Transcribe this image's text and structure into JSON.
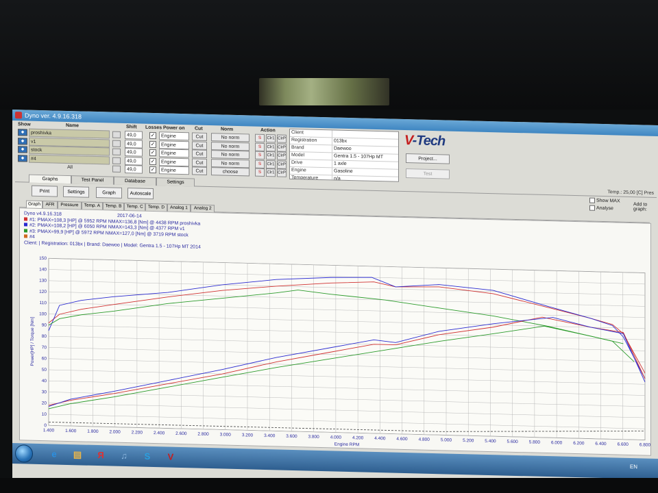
{
  "window": {
    "title": "Dyno ver. 4.9.16.318"
  },
  "channels": {
    "headers": {
      "show": "Show",
      "name": "Name",
      "shift": "Shift",
      "losses": "Losses",
      "power_on": "Power on",
      "cut": "Cut",
      "norm": "Norm",
      "action": "Action"
    },
    "rows": [
      {
        "name": "proshivka",
        "shift": "49,0",
        "power_on": "Engine",
        "cut": "Cut",
        "norm": "No norm"
      },
      {
        "name": "v1",
        "shift": "49,0",
        "power_on": "Engine",
        "cut": "Cut",
        "norm": "No norm"
      },
      {
        "name": "stock",
        "shift": "49,0",
        "power_on": "Engine",
        "cut": "Cut",
        "norm": "No norm"
      },
      {
        "name": "#4",
        "shift": "49,0",
        "power_on": "Engine",
        "cut": "Cut",
        "norm": "No norm"
      },
      {
        "name": "All",
        "shift": "49,0",
        "power_on": "Engine",
        "cut": "Cut",
        "norm": "choose"
      }
    ],
    "action_labels": {
      "clear": "Clr1",
      "copy": "ClrP"
    }
  },
  "client_info": [
    {
      "k": "Client",
      "v": ""
    },
    {
      "k": "Registration",
      "v": "013bx"
    },
    {
      "k": "Brand",
      "v": "Daewoo"
    },
    {
      "k": "Model",
      "v": "Gentra 1.5 - 107Hp MT"
    },
    {
      "k": "Drive",
      "v": "1 axle"
    },
    {
      "k": "Engine",
      "v": "Gasoline"
    },
    {
      "k": "Temperature",
      "v": "n/a"
    }
  ],
  "logo": {
    "v": "V",
    "rest": "-Tech"
  },
  "buttons": {
    "project": "Project...",
    "test": "Test",
    "print": "Print",
    "settings": "Settings",
    "graph": "Graph",
    "autoscale": "Autoscale"
  },
  "tabs": [
    "Graphs",
    "Test Panel",
    "Database",
    "Settings"
  ],
  "temp_readout": "Temp.: 25,00 [C]   Pres",
  "options": {
    "show_max": "Show MAX",
    "analyse": "Analyse",
    "add_to_graph": "Add to graph:"
  },
  "subtabs": [
    "Graph",
    "AFR",
    "Pressure",
    "Temp. A",
    "Temp. B",
    "Temp. C",
    "Temp. D",
    "Analog 1",
    "Analog 2"
  ],
  "legend": {
    "version": "Dyno v4.9.16.318",
    "date": "2017-06-14",
    "lines": [
      {
        "text": "#1: PMAX=108,3 [HP] @ 5952 RPM    NMAX=136,8 [Nm] @ 4438 RPM   proshivka",
        "color": "#d03030"
      },
      {
        "text": "#2: PMAX=108,2 [HP] @ 6050 RPM    NMAX=143,3 [Nm] @ 4377 RPM   v1",
        "color": "#2a2ad0"
      },
      {
        "text": "#3: PMAX=99,9 [HP] @ 5972 RPM    NMAX=127,0 [Nm] @ 3719 RPM   stock",
        "color": "#2a9a2a"
      },
      {
        "text": "#4",
        "color": "#d06a20"
      }
    ],
    "client_line": "Client:  | Registration: 013bx | Brand: Daewoo | Model: Gentra 1.5 - 107Hp MT 2014"
  },
  "chart_data": {
    "type": "line",
    "xlabel": "Engine RPM",
    "ylabel": "Power[HP] / Torque [Nm]",
    "xlim": [
      1400,
      6900
    ],
    "ylim": [
      0,
      150
    ],
    "x_ticks": [
      "1.400",
      "1.600",
      "1.800",
      "2.000",
      "2.200",
      "2.400",
      "2.600",
      "2.800",
      "3.000",
      "3.200",
      "3.400",
      "3.600",
      "3.800",
      "4.000",
      "4.200",
      "4.400",
      "4.600",
      "4.800",
      "5.000",
      "5.200",
      "5.400",
      "5.600",
      "5.800",
      "6.000",
      "6.200",
      "6.400",
      "6.600",
      "6.800"
    ],
    "y_ticks": [
      "0",
      "10",
      "20",
      "30",
      "40",
      "50",
      "60",
      "70",
      "80",
      "90",
      "100",
      "110",
      "120",
      "130",
      "140",
      "150"
    ],
    "grid": true,
    "series": [
      {
        "name": "proshivka",
        "kind": "torque",
        "color": "#d03030",
        "x": [
          1400,
          1500,
          1700,
          2000,
          2500,
          3000,
          3500,
          4000,
          4400,
          4600,
          5000,
          5500,
          6000,
          6400,
          6600,
          6700,
          6900
        ],
        "y": [
          92,
          100,
          105,
          110,
          118,
          125,
          130,
          134,
          136,
          132,
          133,
          128,
          117,
          108,
          103,
          95,
          60
        ]
      },
      {
        "name": "v1",
        "kind": "torque",
        "color": "#2a2ad0",
        "x": [
          1400,
          1500,
          1700,
          2000,
          2500,
          3000,
          3500,
          4000,
          4380,
          4600,
          5000,
          5500,
          6000,
          6400,
          6600,
          6700,
          6900
        ],
        "y": [
          85,
          108,
          113,
          117,
          122,
          130,
          136,
          139,
          140,
          132,
          135,
          131,
          118,
          108,
          102,
          92,
          55
        ]
      },
      {
        "name": "stock",
        "kind": "torque",
        "color": "#2a9a2a",
        "x": [
          1400,
          1500,
          1700,
          2000,
          2500,
          3000,
          3500,
          3700,
          4000,
          4500,
          5000,
          5500,
          6000,
          6400,
          6600,
          6800
        ],
        "y": [
          90,
          96,
          100,
          104,
          112,
          118,
          124,
          127,
          124,
          120,
          114,
          108,
          100,
          92,
          88,
          70
        ]
      },
      {
        "name": "proshivka",
        "kind": "power",
        "color": "#d03030",
        "x": [
          1400,
          1600,
          2000,
          2500,
          3000,
          3500,
          4000,
          4400,
          4600,
          5000,
          5500,
          5952,
          6400,
          6700,
          6900
        ],
        "y": [
          18,
          23,
          30,
          40,
          50,
          62,
          72,
          80,
          80,
          90,
          98,
          108,
          100,
          96,
          55
        ]
      },
      {
        "name": "v1",
        "kind": "power",
        "color": "#2a2ad0",
        "x": [
          1400,
          1600,
          2000,
          2500,
          3000,
          3500,
          4000,
          4400,
          4600,
          5000,
          5500,
          6050,
          6400,
          6700,
          6900
        ],
        "y": [
          17,
          24,
          32,
          43,
          54,
          66,
          76,
          84,
          82,
          93,
          101,
          108,
          100,
          95,
          52
        ]
      },
      {
        "name": "stock",
        "kind": "power",
        "color": "#2a9a2a",
        "x": [
          1400,
          1600,
          2000,
          2500,
          3000,
          3500,
          4000,
          4500,
          5000,
          5500,
          5972,
          6400,
          6700
        ],
        "y": [
          15,
          20,
          27,
          37,
          47,
          57,
          66,
          75,
          84,
          92,
          100,
          92,
          86
        ]
      },
      {
        "name": "#4",
        "kind": "baseline",
        "color": "#555555",
        "x": [
          1400,
          3000,
          5000,
          6900
        ],
        "y": [
          3,
          3,
          3,
          8
        ]
      }
    ]
  },
  "taskbar": {
    "items": [
      {
        "name": "ie",
        "label": "e",
        "color": "#2b8fe0"
      },
      {
        "name": "explorer",
        "label": "▤",
        "color": "#e8b54a"
      },
      {
        "name": "yandex",
        "label": "Я",
        "color": "#e03030"
      },
      {
        "name": "media",
        "label": "♫",
        "color": "#8db8e0"
      },
      {
        "name": "skype",
        "label": "S",
        "color": "#2aa0e0"
      },
      {
        "name": "vtech",
        "label": "V",
        "color": "#c41f1f"
      }
    ],
    "lang": "EN"
  }
}
